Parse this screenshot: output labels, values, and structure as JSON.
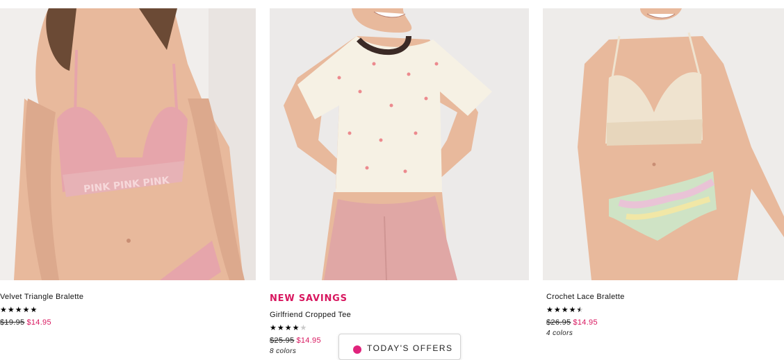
{
  "products": [
    {
      "promo": "",
      "name": "Velvet Triangle Bralette",
      "stars": "★★★★★",
      "rating_label_off": "",
      "old_price": "$19.95",
      "sale_price": "$14.95",
      "colors": ""
    },
    {
      "promo": "NEW SAVINGS",
      "name": "Girlfriend Cropped Tee",
      "stars": "★★★★",
      "rating_label_off": "★",
      "old_price": "$25.95",
      "sale_price": "$14.95",
      "colors": "8 colors"
    },
    {
      "promo": "",
      "name": "Crochet Lace Bralette",
      "stars": "★★★★",
      "rating_label_half": "★",
      "old_price": "$26.95",
      "sale_price": "$14.95",
      "colors": "4 colors"
    }
  ],
  "offers_button": {
    "label": "TODAY'S OFFERS"
  },
  "colors": {
    "accent": "#d8175f",
    "star": "#000000",
    "star_off": "#c9c9c9",
    "skin": "#e8b99c",
    "pink": "#e6a5ab",
    "cream": "#f6f1e4"
  },
  "icons": {
    "rating": "star-icon",
    "offers": "tag-icon"
  }
}
